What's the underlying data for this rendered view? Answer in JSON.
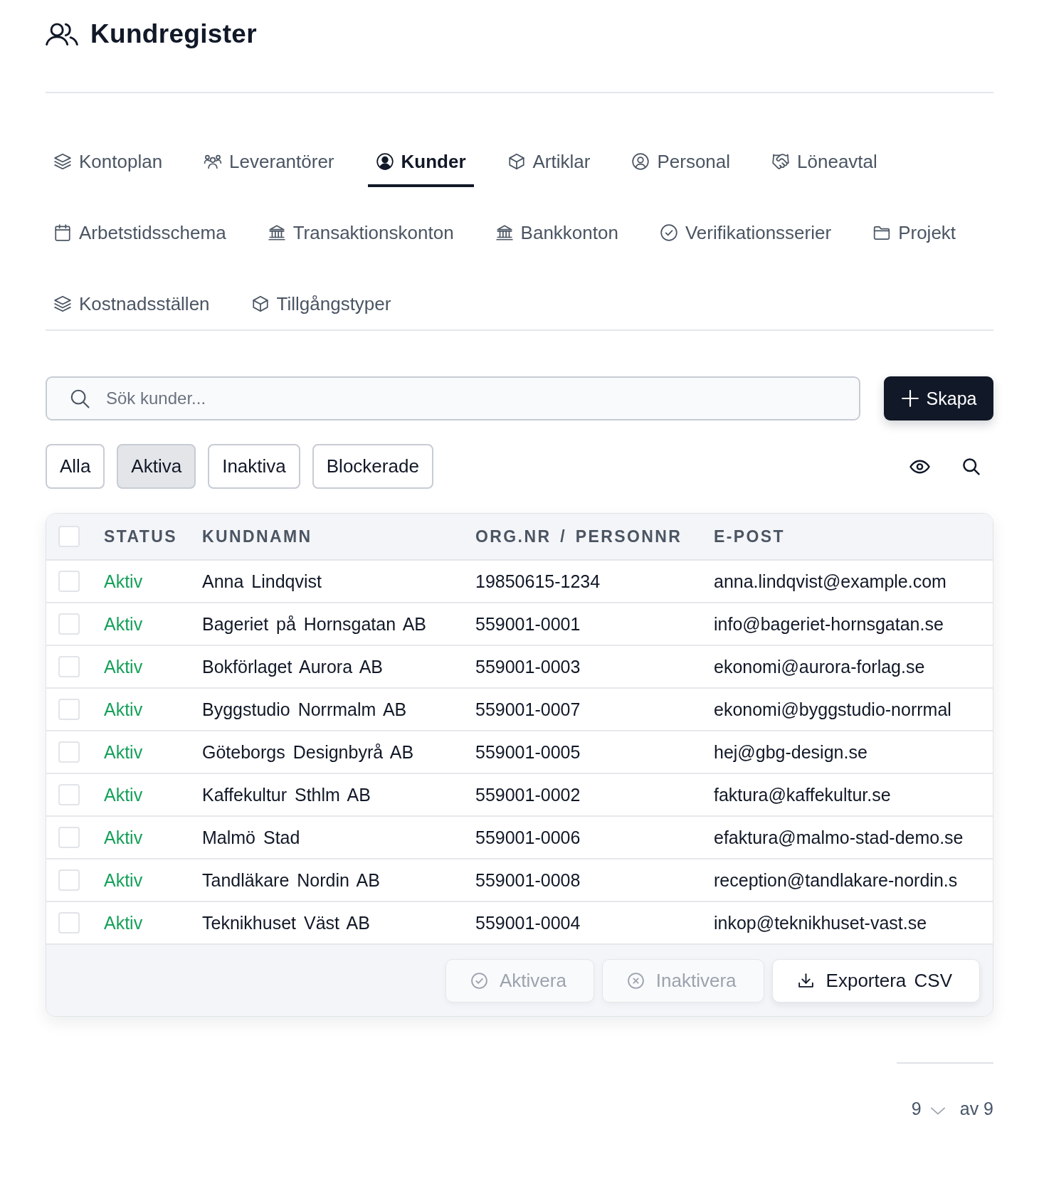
{
  "header": {
    "title": "Kundregister"
  },
  "tabs": [
    {
      "label": "Kontoplan",
      "kind": "layers",
      "selected": false
    },
    {
      "label": "Leverantörer",
      "kind": "group",
      "selected": false
    },
    {
      "label": "Kunder",
      "kind": "customer",
      "selected": true
    },
    {
      "label": "Artiklar",
      "kind": "box",
      "selected": false
    },
    {
      "label": "Personal",
      "kind": "person",
      "selected": false
    },
    {
      "label": "Löneavtal",
      "kind": "handshake",
      "selected": false
    },
    {
      "label": "Arbetstidsschema",
      "kind": "calendar",
      "selected": false
    },
    {
      "label": "Transaktionskonton",
      "kind": "bank",
      "selected": false
    },
    {
      "label": "Bankkonton",
      "kind": "bank",
      "selected": false
    },
    {
      "label": "Verifikationsserier",
      "kind": "check",
      "selected": false
    },
    {
      "label": "Projekt",
      "kind": "folder",
      "selected": false
    },
    {
      "label": "Kostnadsställen",
      "kind": "layers",
      "selected": false
    },
    {
      "label": "Tillgångstyper",
      "kind": "box",
      "selected": false
    }
  ],
  "search": {
    "placeholder": "Sök kunder..."
  },
  "create_button": {
    "label": "Skapa"
  },
  "filters": [
    {
      "label": "Alla",
      "selected": false
    },
    {
      "label": "Aktiva",
      "selected": true
    },
    {
      "label": "Inaktiva",
      "selected": false
    },
    {
      "label": "Blockerade",
      "selected": false
    }
  ],
  "table": {
    "select_all": {
      "checked": false
    },
    "columns": [
      "STATUS",
      "KUNDNAMN",
      "ORG.NR / PERSONNR",
      "E-POST"
    ],
    "rows": [
      {
        "checked": false,
        "status": "Aktiv",
        "name": "Anna Lindqvist",
        "org_nr": "19850615-1234",
        "email": "anna.lindqvist@example.com"
      },
      {
        "checked": false,
        "status": "Aktiv",
        "name": "Bageriet på Hornsgatan AB",
        "org_nr": "559001-0001",
        "email": "info@bageriet-hornsgatan.se"
      },
      {
        "checked": false,
        "status": "Aktiv",
        "name": "Bokförlaget Aurora AB",
        "org_nr": "559001-0003",
        "email": "ekonomi@aurora-forlag.se"
      },
      {
        "checked": false,
        "status": "Aktiv",
        "name": "Byggstudio Norrmalm AB",
        "org_nr": "559001-0007",
        "email": "ekonomi@byggstudio-norrmal"
      },
      {
        "checked": false,
        "status": "Aktiv",
        "name": "Göteborgs Designbyrå AB",
        "org_nr": "559001-0005",
        "email": "hej@gbg-design.se"
      },
      {
        "checked": false,
        "status": "Aktiv",
        "name": "Kaffekultur Sthlm AB",
        "org_nr": "559001-0002",
        "email": "faktura@kaffekultur.se"
      },
      {
        "checked": false,
        "status": "Aktiv",
        "name": "Malmö Stad",
        "org_nr": "559001-0006",
        "email": "efaktura@malmo-stad-demo.se"
      },
      {
        "checked": false,
        "status": "Aktiv",
        "name": "Tandläkare Nordin AB",
        "org_nr": "559001-0008",
        "email": "reception@tandlakare-nordin.s"
      },
      {
        "checked": false,
        "status": "Aktiv",
        "name": "Teknikhuset Väst AB",
        "org_nr": "559001-0004",
        "email": "inkop@teknikhuset-vast.se"
      }
    ],
    "actions": [
      {
        "label": "Aktivera",
        "kind": "activate",
        "disabled": true
      },
      {
        "label": "Inaktivera",
        "kind": "deactivate",
        "disabled": true
      },
      {
        "label": "Exportera CSV",
        "kind": "export",
        "disabled": false
      }
    ]
  },
  "pagination": {
    "page_size": "9",
    "total": "av 9"
  }
}
